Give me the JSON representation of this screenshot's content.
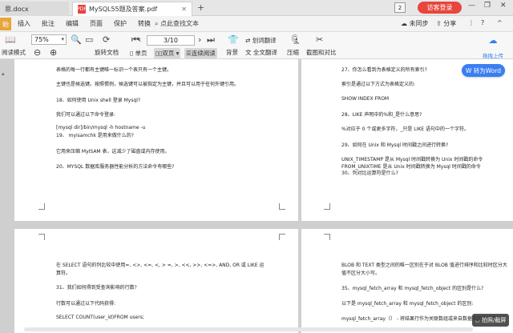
{
  "tabs": {
    "doc_tab": "思.docx",
    "pdf_tab": "MySQL55题及答案.pdf",
    "pdf_icon": "PDF",
    "add_tab": "+",
    "badge_count": "2",
    "login": "访客登录",
    "controls": [
      "—",
      "❐",
      "✕"
    ]
  },
  "menubar": {
    "first": "始",
    "items": [
      "插入",
      "批注",
      "编辑",
      "页面",
      "保护",
      "转换"
    ],
    "search": "点此查找文本",
    "right": [
      "未同步",
      "分享",
      "⋮",
      "?",
      "^"
    ]
  },
  "ribbon": {
    "zoom": "75%",
    "page_indicator": "3/10",
    "read_mode": "阅读模式",
    "rotate": "旋转文档",
    "single_page": "单页",
    "double_page": "双页",
    "continuous": "连续阅读",
    "background": "背景",
    "translate_select": "划词翻译",
    "compress": "压缩",
    "full_translate": "全文翻译",
    "screenshot": "截图和对比",
    "cloud_upload": "拖拽上传"
  },
  "convert_word": "转为Word",
  "pages": {
    "left_top": [
      "表格的每一行都有主键唯一标识一个表只有一个主键。",
      "主键也是候选键。按照惯例，候选键可以被指定为主键，并且可以用于任何外键引用。",
      "18、如何使用 Unix shell 登录 Mysql?",
      "我们可以通过以下命令登录:",
      "[mysql dir]/bin/mysql -h hostname -u",
      "19、 myisamchk 是用来做什么的?",
      "它用来压缩 MyISAM 表，这减少了磁盘或内存使用。",
      "20、MYSQL 数据库服务器性能分析的方法命令有哪些?"
    ],
    "right_top": [
      "27、你怎么看到为表格定义的所有索引?",
      "索引是通过以下方式为表格定义的:",
      "SHOW INDEX FROM",
      "28、LIKE 声明中的%和_是什么意思?",
      "%对应于 0 个或更多字符，_只是 LIKE 语句中的一个字符。",
      "29、如何在 Unix 和 Mysql 时间戳之间进行转换?",
      "UNIX_TIMESTAMP 是从 Mysql 时间戳转换为 Unix 时间戳的命令",
      "FROM_UNIXTIME 是从 Unix 时间戳转换为 Mysql 时间戳的命令",
      "30、列对比运算符是什么?"
    ],
    "left_bottom": [
      "在 SELECT 语句的列比较中使用=, <>, <=, <, > =, >, <<, >>, <=>, AND, OR 或 LIKE 运",
      "算符。",
      "31、我们如何得到受查询影响的行数?",
      "行数可以通过以下代码获得:",
      "SELECT COUNT(user_id)FROM users;"
    ],
    "right_bottom": [
      "BLOB 和 TEXT 类型之间的唯一区别在于对 BLOB 值进行排序和比较时区分大",
      "值不区分大小写。",
      "35、mysql_fetch_array 和 mysql_fetch_object 的区别是什么?",
      "以下是 mysql_fetch_array 和 mysql_fetch_object 的区别:",
      "mysql_fetch_array（） - 将结果行作为关联数组或来自数据库的常规数组返"
    ]
  },
  "bottom_bubble": "◡ 拍照/截屏"
}
